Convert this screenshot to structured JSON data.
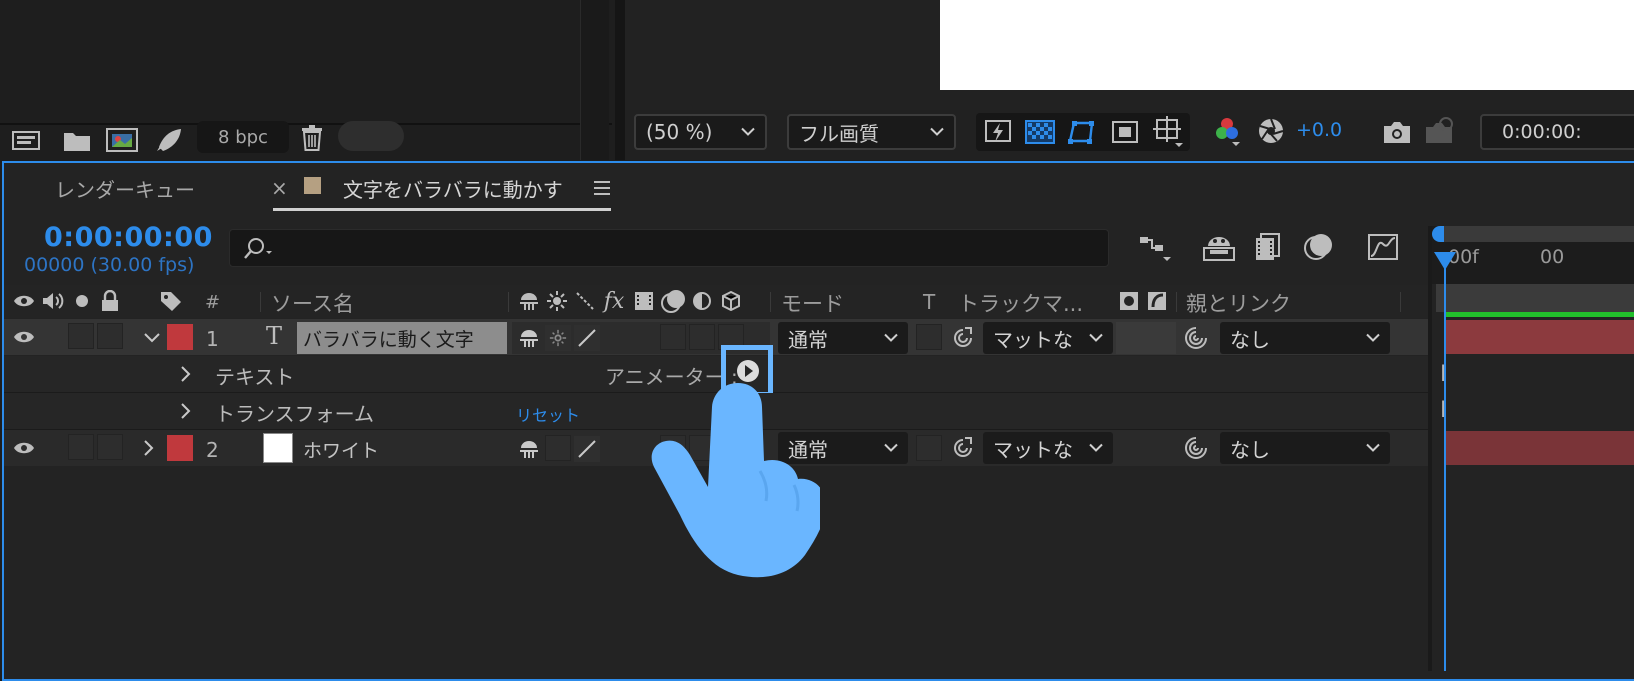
{
  "project_panel": {
    "bpc": "8 bpc"
  },
  "viewer": {
    "zoom": "(50 %)",
    "quality": "フル画質",
    "exposure": "+0.0",
    "timecode": "0:00:00:"
  },
  "tabs": [
    {
      "label": "レンダーキュー"
    },
    {
      "label": "文字をバラバラに動かす",
      "close": "×",
      "active": true
    }
  ],
  "timeline": {
    "current_time": "0:00:00:00",
    "frame_info": "00000 (30.00 fps)",
    "search_placeholder": "",
    "ruler": {
      "start": "00f",
      "next": "00"
    },
    "columns": {
      "number": "#",
      "source_name": "ソース名",
      "mode": "モード",
      "t": "T",
      "track_matte": "トラックマ...",
      "parent_link": "親とリンク"
    },
    "layers": [
      {
        "number": "1",
        "type_icon": "T",
        "name": "バラバラに動く文字",
        "mode": "通常",
        "matte": "マットな",
        "parent": "なし",
        "label_color": "#c0393d"
      },
      {
        "number": "2",
        "name": "ホワイト",
        "mode": "通常",
        "matte": "マットな",
        "parent": "なし",
        "label_color": "#c0393d"
      }
    ],
    "properties": [
      {
        "label": "テキスト",
        "animator_label": "アニメーター :"
      },
      {
        "label": "トランスフォーム",
        "reset_label": "リセット"
      }
    ]
  },
  "colors": {
    "accent_blue": "#2d8ceb",
    "hand_pointer": "#6ab6ff",
    "layer_bar": "#8c3a3e",
    "label_red": "#c0393d"
  }
}
